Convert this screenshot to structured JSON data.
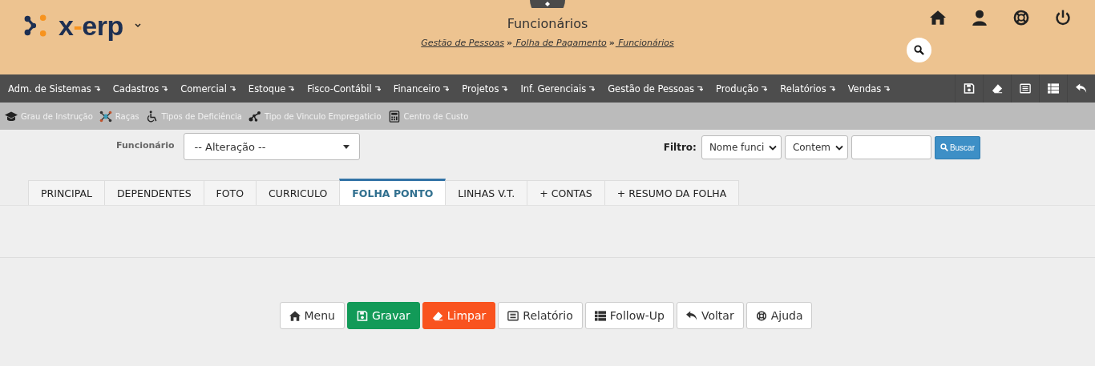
{
  "header": {
    "logo": {
      "prefix": "x",
      "dash": "-",
      "suffix": "erp"
    },
    "title": "Funcionários",
    "breadcrumb": [
      {
        "label": "Gestão de Pessoas",
        "separator": "»"
      },
      {
        "label": " Folha de Pagamento",
        "separator": "»"
      },
      {
        "label": " Funcionários"
      }
    ]
  },
  "main_menu": [
    {
      "label": "Adm. de Sistemas"
    },
    {
      "label": "Cadastros"
    },
    {
      "label": "Comercial"
    },
    {
      "label": "Estoque"
    },
    {
      "label": "Fisco-Contábil"
    },
    {
      "label": "Financeiro"
    },
    {
      "label": "Projetos"
    },
    {
      "label": "Inf. Gerenciais"
    },
    {
      "label": "Gestão de Pessoas"
    },
    {
      "label": "Produção"
    },
    {
      "label": "Relatórios"
    },
    {
      "label": "Vendas"
    }
  ],
  "sub_menu": [
    {
      "label": "Grau de Instrução"
    },
    {
      "label": "Raças"
    },
    {
      "label": "Tipos de Deficiência"
    },
    {
      "label": "Tipo de Vinculo Empregaticio"
    },
    {
      "label": "Centro de Custo"
    }
  ],
  "form": {
    "employee_label": "Funcionário",
    "employee_select": "-- Alteração --",
    "filter_label": "Filtro:",
    "filter_field": "Nome funci",
    "filter_operator": "Contem",
    "search_button": "Buscar"
  },
  "tabs": [
    {
      "label": "PRINCIPAL",
      "selected": false
    },
    {
      "label": "DEPENDENTES",
      "selected": false
    },
    {
      "label": "FOTO",
      "selected": false
    },
    {
      "label": "CURRICULO",
      "selected": false
    },
    {
      "label": "FOLHA PONTO",
      "selected": true
    },
    {
      "label": "LINHAS V.T.",
      "selected": false
    },
    {
      "label": "+ CONTAS",
      "selected": false
    },
    {
      "label": "+ RESUMO DA FOLHA",
      "selected": false
    }
  ],
  "buttons": [
    {
      "label": "Menu",
      "kind": "default"
    },
    {
      "label": "Gravar",
      "kind": "success"
    },
    {
      "label": "Limpar",
      "kind": "danger"
    },
    {
      "label": "Relatório",
      "kind": "default"
    },
    {
      "label": "Follow-Up",
      "kind": "default"
    },
    {
      "label": "Voltar",
      "kind": "default"
    },
    {
      "label": "Ajuda",
      "kind": "default"
    }
  ]
}
